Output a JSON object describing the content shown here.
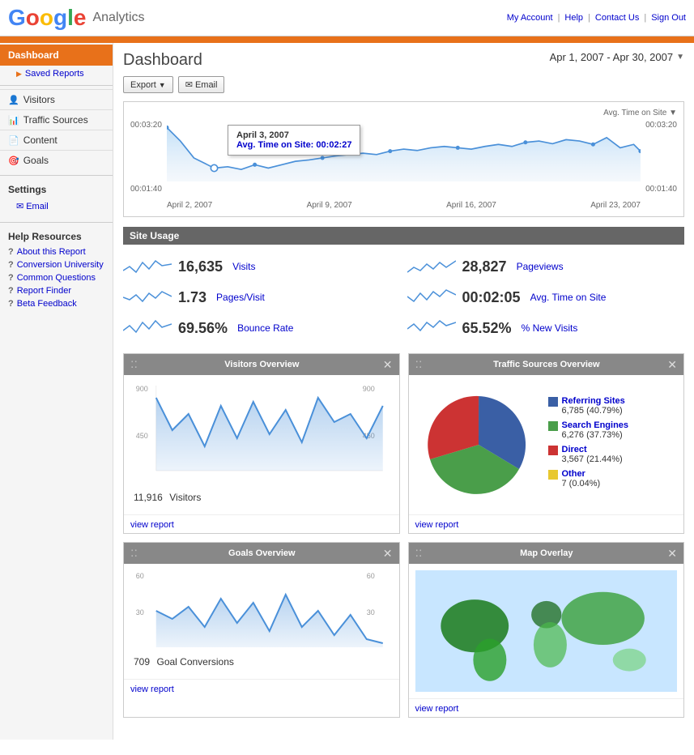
{
  "header": {
    "logo": "Google Analytics",
    "links": [
      "My Account",
      "Help",
      "Contact Us",
      "Sign Out"
    ]
  },
  "nav": {
    "links": [
      {
        "label": "My Account",
        "href": "#"
      },
      {
        "label": "Help",
        "href": "#"
      },
      {
        "label": "Contact Us",
        "href": "#"
      },
      {
        "label": "Sign Out",
        "href": "#"
      }
    ]
  },
  "sidebar": {
    "dashboard": "Dashboard",
    "saved_reports": "Saved Reports",
    "visitors": "Visitors",
    "traffic_sources": "Traffic Sources",
    "content": "Content",
    "goals": "Goals",
    "settings": "Settings",
    "email": "Email",
    "help_resources": "Help Resources",
    "about_report": "About this Report",
    "conversion_university": "Conversion University",
    "common_questions": "Common Questions",
    "report_finder": "Report Finder",
    "beta_feedback": "Beta Feedback"
  },
  "dashboard": {
    "title": "Dashboard",
    "date_range": "Apr 1, 2007 - Apr 30, 2007",
    "export_label": "Export",
    "email_label": "Email"
  },
  "chart": {
    "y_top": "00:03:20",
    "y_bottom": "00:01:40",
    "y_top_right": "00:03:20",
    "y_bottom_right": "00:01:40",
    "label": "Avg. Time on Site ▼",
    "x_labels": [
      "April 2, 2007",
      "April 9, 2007",
      "April 16, 2007",
      "April 23, 2007"
    ],
    "tooltip": {
      "date": "April 3, 2007",
      "label": "Avg. Time on Site:",
      "value": "00:02:27"
    }
  },
  "site_usage": {
    "title": "Site Usage",
    "metrics": [
      {
        "value": "16,635",
        "label": "Visits"
      },
      {
        "value": "28,827",
        "label": "Pageviews"
      },
      {
        "value": "1.73",
        "label": "Pages/Visit"
      },
      {
        "value": "00:02:05",
        "label": "Avg. Time on Site"
      },
      {
        "value": "69.56%",
        "label": "Bounce Rate"
      },
      {
        "value": "65.52%",
        "label": "% New Visits"
      }
    ]
  },
  "visitors_overview": {
    "title": "Visitors Overview",
    "stat": "11,916",
    "stat_label": "Visitors",
    "view_report": "view report"
  },
  "traffic_overview": {
    "title": "Traffic Sources Overview",
    "view_report": "view report",
    "legend": [
      {
        "label": "Referring Sites",
        "value": "6,785 (40.79%)",
        "color": "#3a5fa5"
      },
      {
        "label": "Search Engines",
        "value": "6,276 (37.73%)",
        "color": "#4a9e4a"
      },
      {
        "label": "Direct",
        "value": "3,567 (21.44%)",
        "color": "#cc3333"
      },
      {
        "label": "Other",
        "value": "7 (0.04%)",
        "color": "#e8c830"
      }
    ]
  },
  "goals_overview": {
    "title": "Goals Overview",
    "stat": "709",
    "stat_label": "Goal Conversions",
    "view_report": "view report"
  },
  "map_overlay": {
    "title": "Map Overlay",
    "view_report": "view report"
  }
}
